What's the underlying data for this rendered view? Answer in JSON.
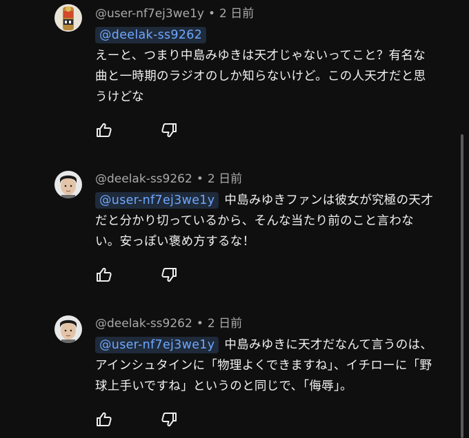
{
  "comments": [
    {
      "author": "@user-nf7ej3we1y",
      "time": "2 日前",
      "mention": "@deelak-ss9262",
      "text": "えーと、つまり中島みゆきは天才じゃないってこと？有名な曲と一時期のラジオのしか知らないけど。この人天才だと思うけどな",
      "avatar": "figurine-avatar",
      "like_icon": "thumb-up-icon",
      "dislike_icon": "thumb-down-icon"
    },
    {
      "author": "@deelak-ss9262",
      "time": "2 日前",
      "mention": "@user-nf7ej3we1y",
      "text": "中島みゆきファンは彼女が究極の天才だと分かり切っているから、そんな当たり前のこと言わない。安っぽい褒め方するな！",
      "avatar": "face-photo-avatar",
      "like_icon": "thumb-up-icon",
      "dislike_icon": "thumb-down-icon"
    },
    {
      "author": "@deelak-ss9262",
      "time": "2 日前",
      "mention": "@user-nf7ej3we1y",
      "text": "中島みゆきに天才だなんて言うのは、アインシュタインに「物理よくできますね」、イチローに「野球上手いですね」というのと同じで、「侮辱」。",
      "avatar": "face-photo-avatar",
      "like_icon": "thumb-up-icon",
      "dislike_icon": "thumb-down-icon"
    }
  ],
  "colors": {
    "background": "#0f0f0f",
    "text": "#f1f1f1",
    "meta": "#aaaaaa",
    "mention_text": "#6ea8fe",
    "mention_bg": "#1f2a3a"
  }
}
